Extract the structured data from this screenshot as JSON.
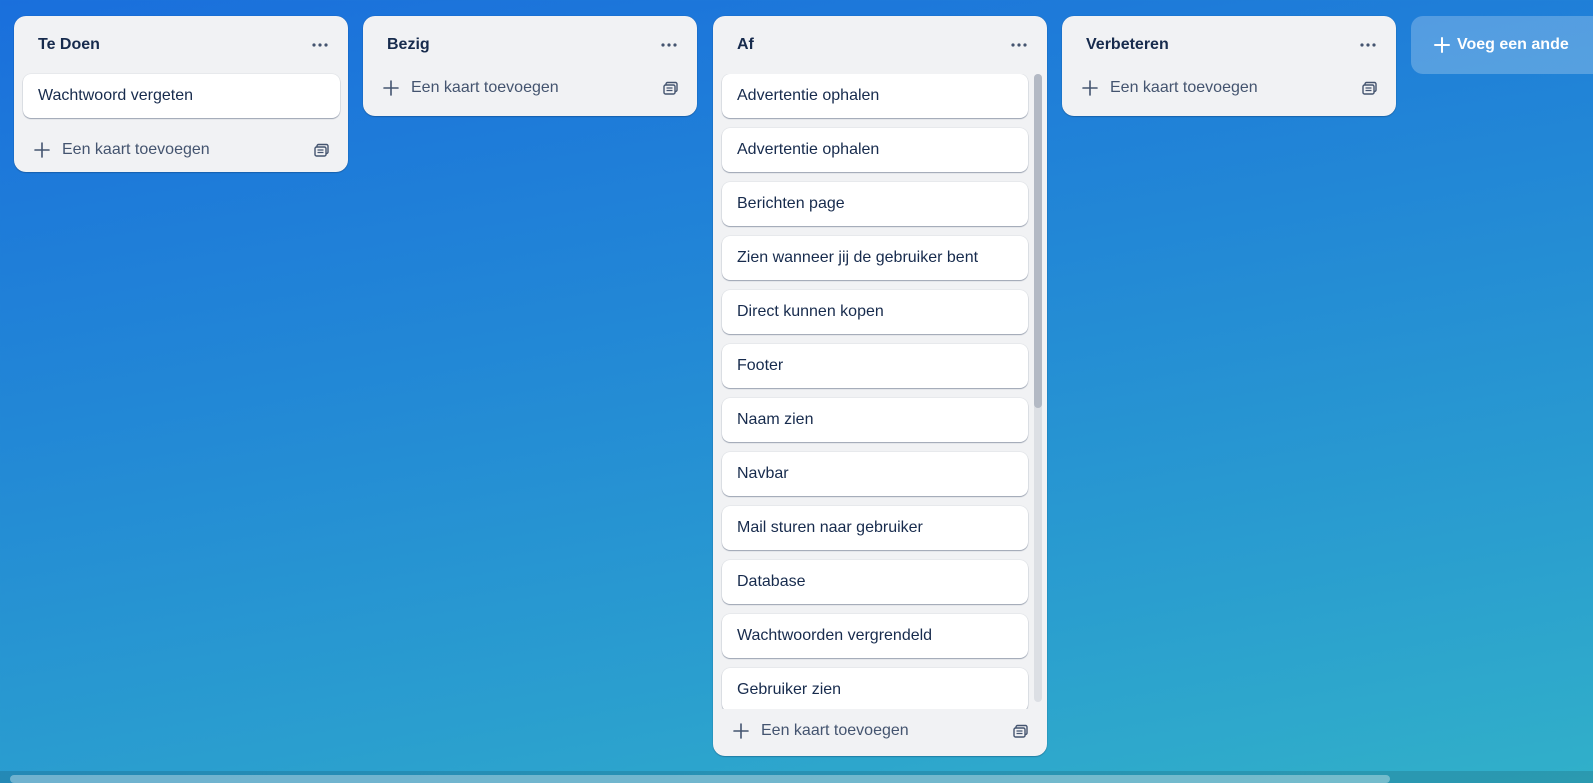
{
  "lists": [
    {
      "title": "Te Doen",
      "cards": [
        "Wachtwoord vergeten"
      ],
      "add_card_label": "Een kaart toevoegen",
      "menu_icon": "ellipsis-icon",
      "template_icon": "card-template-icon"
    },
    {
      "title": "Bezig",
      "cards": [],
      "add_card_label": "Een kaart toevoegen",
      "menu_icon": "ellipsis-icon",
      "template_icon": "card-template-icon"
    },
    {
      "title": "Af",
      "cards": [
        "Advertentie ophalen",
        "Advertentie ophalen",
        "Berichten page",
        "Zien wanneer jij de gebruiker bent",
        "Direct kunnen kopen",
        "Footer",
        "Naam zien",
        "Navbar",
        "Mail sturen naar gebruiker",
        "Database",
        "Wachtwoorden vergrendeld",
        "Gebruiker zien"
      ],
      "add_card_label": "Een kaart toevoegen",
      "menu_icon": "ellipsis-icon",
      "template_icon": "card-template-icon"
    },
    {
      "title": "Verbeteren",
      "cards": [],
      "add_card_label": "Een kaart toevoegen",
      "menu_icon": "ellipsis-icon",
      "template_icon": "card-template-icon"
    }
  ],
  "add_list_label": "Voeg een ande",
  "colors": {
    "background_start": "#1a6fdc",
    "background_end": "#31b0c9",
    "list_bg": "#f1f2f4",
    "card_bg": "#ffffff",
    "text": "#172b4d",
    "muted_text": "#44546f"
  }
}
